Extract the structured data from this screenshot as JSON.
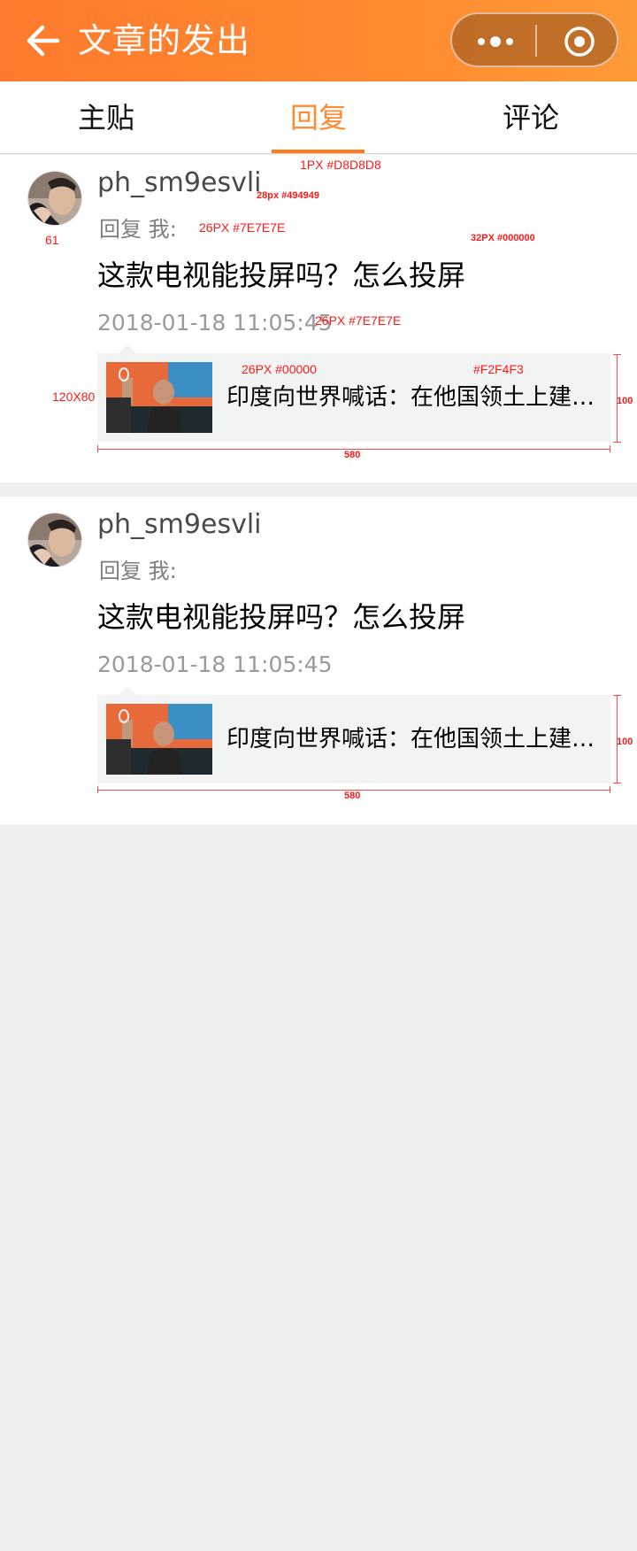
{
  "header": {
    "title": "文章的发出",
    "back_icon": "arrow-left-icon",
    "menu_icon": "more-dots-icon",
    "close_icon": "record-circle-icon",
    "color_start": "#ff7a2e",
    "color_end": "#ff9a38"
  },
  "tabs": [
    {
      "label": "主贴",
      "active": false
    },
    {
      "label": "回复",
      "active": true
    },
    {
      "label": "评论",
      "active": false
    }
  ],
  "accent_color": "#ff8a30",
  "replies": [
    {
      "username": "ph_sm9esvli",
      "reply_label": "回复 我:",
      "content": "这款电视能投屏吗？怎么投屏",
      "time": "2018-01-18 11:05:45",
      "quote_text": "印度向世界喊话：在他国领土上建设基础设施"
    },
    {
      "username": "ph_sm9esvli",
      "reply_label": "回复 我:",
      "content": "这款电视能投屏吗？怎么投屏",
      "time": "2018-01-18 11:05:45",
      "quote_text": "印度向世界喊话：在他国领土上建设基础设施"
    }
  ],
  "annotations": {
    "divider": "1PX #D8D8D8",
    "username_spec": "28px #494949",
    "reply_spec": "26PX #7E7E7E",
    "content_spec": "32PX #000000",
    "time_spec": "26PX #7E7E7E",
    "quote_text_spec": "26PX #00000",
    "quote_bg": "#F2F4F3",
    "thumb_size": "120X80",
    "avatar_size": "61",
    "quote_height": "100",
    "quote_width": "580"
  }
}
